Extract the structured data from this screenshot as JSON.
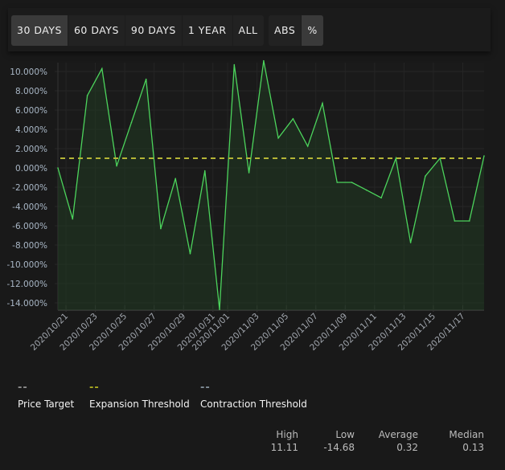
{
  "toolbar": {
    "range_buttons": [
      {
        "label": "30 DAYS",
        "active": true
      },
      {
        "label": "60 DAYS",
        "active": false
      },
      {
        "label": "90 DAYS",
        "active": false
      },
      {
        "label": "1 YEAR",
        "active": false
      },
      {
        "label": "ALL",
        "active": false
      }
    ],
    "mode_buttons": [
      {
        "label": "ABS",
        "active": false
      },
      {
        "label": "%",
        "active": true
      }
    ]
  },
  "chart_data": {
    "type": "area",
    "ylim": [
      -14.68,
      11.11
    ],
    "y_ticks": [
      "10.000%",
      "8.000%",
      "6.000%",
      "4.000%",
      "2.000%",
      "0.000%",
      "-2.000%",
      "-4.000%",
      "-6.000%",
      "-8.000%",
      "-10.000%",
      "-12.000%",
      "-14.000%"
    ],
    "y_tick_values": [
      10,
      8,
      6,
      4,
      2,
      0,
      -2,
      -4,
      -6,
      -8,
      -10,
      -12,
      -14
    ],
    "x_ticks": [
      "2020/10/21",
      "2020/10/23",
      "2020/10/25",
      "2020/10/27",
      "2020/10/29",
      "2020/10/31",
      "2020/11/01",
      "2020/11/03",
      "2020/11/05",
      "2020/11/07",
      "2020/11/09",
      "2020/11/11",
      "2020/11/13",
      "2020/11/15",
      "2020/11/17"
    ],
    "grid": true,
    "series": [
      {
        "color": "#4cd45c",
        "x": [
          "2020/10/20",
          "2020/10/21",
          "2020/10/22",
          "2020/10/23",
          "2020/10/24",
          "2020/10/25",
          "2020/10/26",
          "2020/10/27",
          "2020/10/28",
          "2020/10/29",
          "2020/10/30",
          "2020/10/31",
          "2020/11/01",
          "2020/11/02",
          "2020/11/03",
          "2020/11/04",
          "2020/11/05",
          "2020/11/06",
          "2020/11/07",
          "2020/11/08",
          "2020/11/09",
          "2020/11/10",
          "2020/11/11",
          "2020/11/12",
          "2020/11/13",
          "2020/11/14",
          "2020/11/15",
          "2020/11/16",
          "2020/11/17",
          "2020/11/18"
        ],
        "values": [
          0,
          -5.3,
          7.5,
          10.3,
          0.2,
          4.7,
          9.2,
          -6.3,
          -1.1,
          -8.9,
          -0.3,
          -14.68,
          10.7,
          -0.5,
          11.11,
          3.1,
          5.1,
          2.25,
          6.7,
          -1.5,
          -1.5,
          -2.3,
          -3.1,
          1.0,
          -7.75,
          -0.85,
          1.0,
          -5.5,
          -5.5,
          1.25
        ]
      }
    ],
    "threshold_line": {
      "value": 1.0,
      "color": "#b5b536"
    }
  },
  "legend": [
    {
      "label": "Price Target",
      "color": "#8a8a8a"
    },
    {
      "label": "Expansion Threshold",
      "color": "#a8a820"
    },
    {
      "label": "Contraction Threshold",
      "color": "#7f8c95"
    }
  ],
  "stats": [
    {
      "label": "High",
      "value": "11.11"
    },
    {
      "label": "Low",
      "value": "-14.68"
    },
    {
      "label": "Average",
      "value": "0.32"
    },
    {
      "label": "Median",
      "value": "0.13"
    }
  ]
}
